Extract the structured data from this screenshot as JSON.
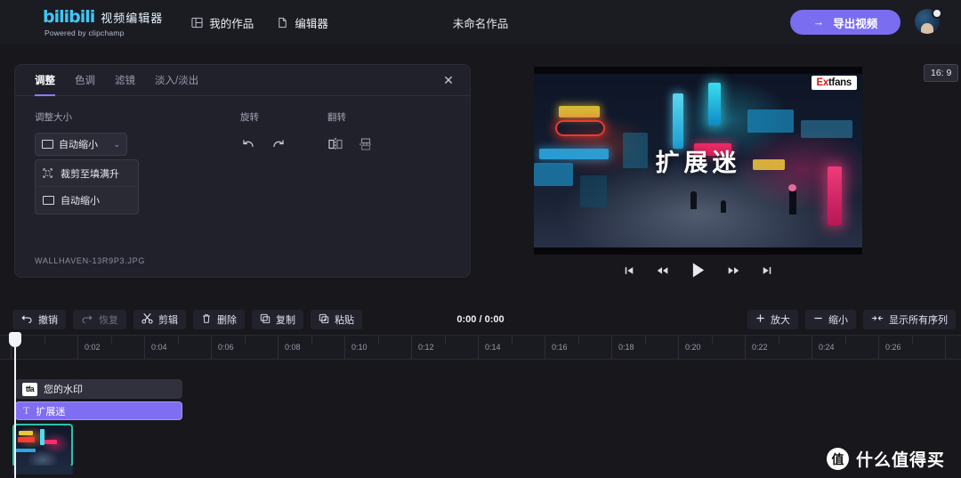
{
  "topbar": {
    "logo_text": "bilibili",
    "brand_name": "视频编辑器",
    "brand_sub": "Powered by clipchamp",
    "nav": [
      {
        "label": "我的作品",
        "icon": "grid-icon"
      },
      {
        "label": "编辑器",
        "icon": "file-icon"
      }
    ],
    "doc_title": "未命名作品",
    "export_label": "导出视频",
    "export_arrow": "→",
    "accent_color": "#7a6df0"
  },
  "panel": {
    "tabs": [
      {
        "label": "调整",
        "active": true
      },
      {
        "label": "色调",
        "active": false
      },
      {
        "label": "滤镜",
        "active": false
      },
      {
        "label": "淡入/淡出",
        "active": false
      }
    ],
    "close_glyph": "✕",
    "resize_label": "调整大小",
    "select_value": "自动缩小",
    "chevron": "⌄",
    "dropdown_options": [
      "裁剪至填满升",
      "自动缩小"
    ],
    "rotate_label": "旋转",
    "flip_label": "翻转",
    "filename": "WALLHAVEN-13R9P3.JPG"
  },
  "preview": {
    "overlay_text": "扩展迷",
    "watermark_red": "Ex",
    "watermark_rest": "tfans",
    "ratio_badge": "16: 9",
    "controls": [
      {
        "name": "skip-to-start",
        "glyph": "skip-start"
      },
      {
        "name": "rewind",
        "glyph": "rewind"
      },
      {
        "name": "play",
        "glyph": "play"
      },
      {
        "name": "fast-forward",
        "glyph": "forward"
      },
      {
        "name": "skip-to-end",
        "glyph": "skip-end"
      }
    ]
  },
  "timeline_toolbar": {
    "left_buttons": [
      {
        "label": "撤销",
        "icon": "undo-icon",
        "dim": false
      },
      {
        "label": "恢复",
        "icon": "redo-icon",
        "dim": true
      },
      {
        "label": "剪辑",
        "icon": "scissors-icon",
        "dim": false
      },
      {
        "label": "删除",
        "icon": "trash-icon",
        "dim": false
      },
      {
        "label": "复制",
        "icon": "copy-icon",
        "dim": false
      },
      {
        "label": "粘贴",
        "icon": "paste-icon",
        "dim": false
      }
    ],
    "timecode": "0:00 / 0:00",
    "right_buttons": [
      {
        "label": "放大",
        "icon": "plus-icon"
      },
      {
        "label": "缩小",
        "icon": "minus-icon"
      },
      {
        "label": "显示所有序列",
        "icon": "fit-icon"
      }
    ]
  },
  "ruler": {
    "labels": [
      "0:02",
      "0:04",
      "0:06",
      "0:08",
      "0:10",
      "0:12",
      "0:14",
      "0:16",
      "0:18",
      "0:20",
      "0:22",
      "0:24",
      "0:26"
    ],
    "first_label_x": 95,
    "spacing": 75
  },
  "tracks": {
    "watermark_clip": {
      "label": "您的水印",
      "icon_text": "tfa"
    },
    "text_clip": {
      "label": "扩展迷",
      "icon": "T",
      "color": "#7f6df2"
    },
    "media_clip": {
      "name": "image-clip",
      "border_color": "#2fc2a8"
    }
  },
  "bottom_watermark": {
    "mark": "值",
    "text": "什么值得买"
  }
}
